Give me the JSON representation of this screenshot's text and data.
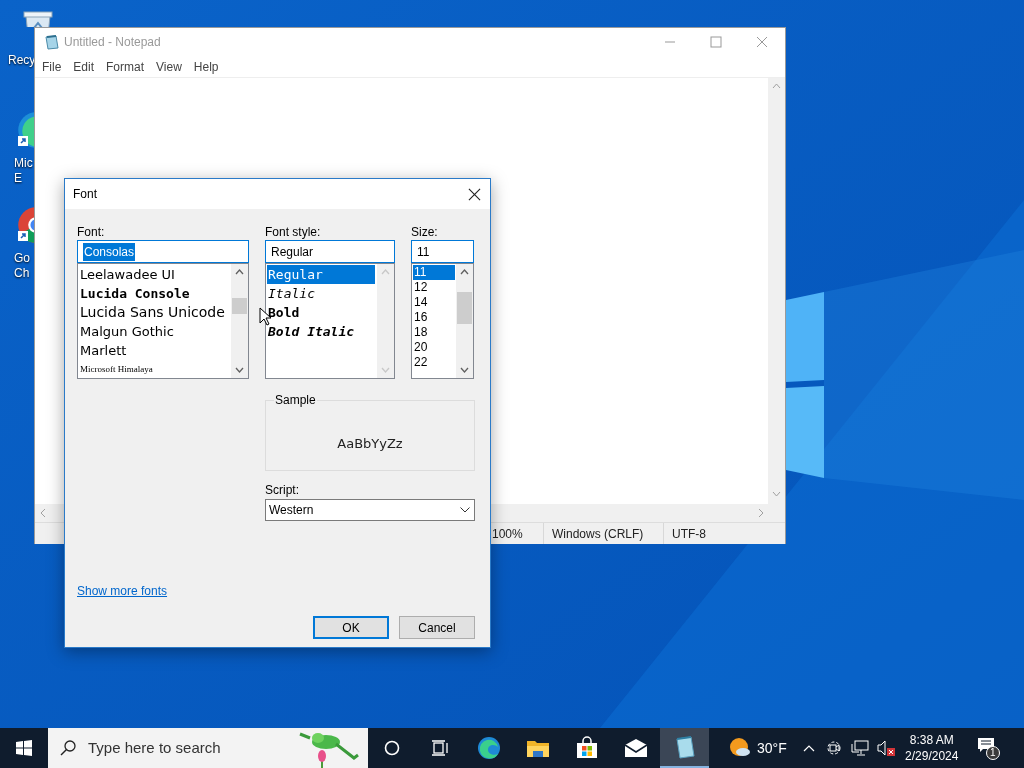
{
  "desktop_icons": [
    {
      "kind": "recycle-bin",
      "lines": [
        "Recy"
      ]
    },
    {
      "kind": "edge",
      "lines": [
        "Mic",
        "E"
      ]
    },
    {
      "kind": "chrome",
      "lines": [
        "Go",
        "Ch"
      ]
    }
  ],
  "notepad": {
    "title": "Untitled - Notepad",
    "menu": [
      "File",
      "Edit",
      "Format",
      "View",
      "Help"
    ],
    "status_bar": [
      "100%",
      "Windows (CRLF)",
      "UTF-8"
    ]
  },
  "font_dialog": {
    "title": "Font",
    "font": {
      "label": "Font:",
      "value": "Consolas",
      "items": [
        {
          "label": "Leelawadee UI",
          "kind": "sans",
          "selected": false
        },
        {
          "label": "Lucida Console",
          "kind": "mono",
          "selected": false
        },
        {
          "label": "Lucida Sans Unicode",
          "kind": "sans-large",
          "selected": false
        },
        {
          "label": "Malgun Gothic",
          "kind": "sans",
          "selected": false
        },
        {
          "label": "Marlett",
          "kind": "sans",
          "selected": false
        },
        {
          "label": "Microsoft Himalaya",
          "kind": "serif-small",
          "selected": false
        }
      ]
    },
    "style": {
      "label": "Font style:",
      "value": "Regular",
      "items": [
        {
          "label": "Regular",
          "kind": "regular",
          "selected": true
        },
        {
          "label": "Italic",
          "kind": "italic",
          "selected": false
        },
        {
          "label": "Bold",
          "kind": "bold",
          "selected": false
        },
        {
          "label": "Bold Italic",
          "kind": "bold-italic",
          "selected": false
        }
      ]
    },
    "size": {
      "label": "Size:",
      "value": "11",
      "items": [
        {
          "label": "11",
          "selected": true
        },
        {
          "label": "12",
          "selected": false
        },
        {
          "label": "14",
          "selected": false
        },
        {
          "label": "16",
          "selected": false
        },
        {
          "label": "18",
          "selected": false
        },
        {
          "label": "20",
          "selected": false
        },
        {
          "label": "22",
          "selected": false
        }
      ]
    },
    "sample": {
      "label": "Sample",
      "text": "AaBbYyZz"
    },
    "script": {
      "label": "Script:",
      "value": "Western"
    },
    "link": "Show more fonts",
    "buttons": [
      {
        "label": "OK",
        "default": true
      },
      {
        "label": "Cancel",
        "default": false
      }
    ]
  },
  "taskbar": {
    "search": {
      "placeholder": "Type here to search"
    },
    "apps": [
      {
        "kind": "edge",
        "selected": false
      },
      {
        "kind": "folder",
        "selected": false
      },
      {
        "kind": "store",
        "selected": false
      },
      {
        "kind": "mail",
        "selected": false
      },
      {
        "kind": "notepad",
        "selected": true
      }
    ],
    "weather": "30°F",
    "time": "8:38 AM",
    "date": "2/29/2024",
    "notifications": "1"
  }
}
